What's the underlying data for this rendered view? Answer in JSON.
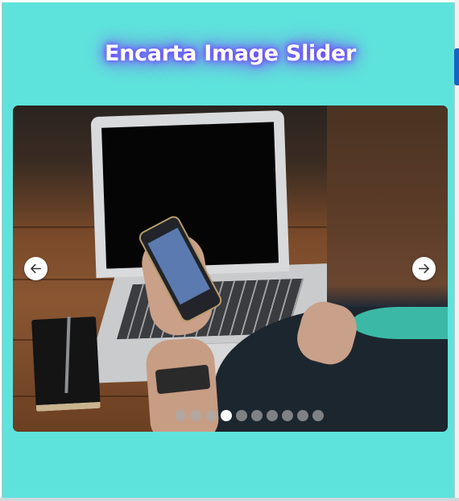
{
  "app": {
    "title": "Encarta Image Slider"
  },
  "slider": {
    "image_alt": "Person holding a smartphone beside a laptop",
    "prev_icon": "arrow-left-icon",
    "next_icon": "arrow-right-icon",
    "dot_count": 10,
    "active_index": 3
  },
  "colors": {
    "background": "#5ee3dc",
    "title_glow": "#6b3cff",
    "dot_inactive": "#aaaaaa",
    "dot_active": "#ffffff"
  }
}
